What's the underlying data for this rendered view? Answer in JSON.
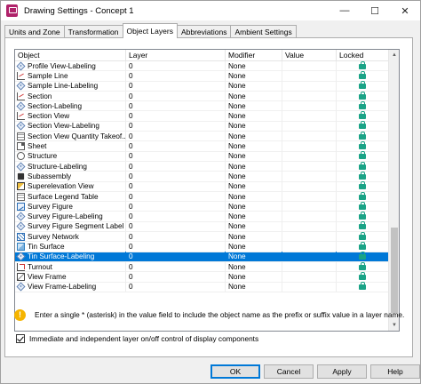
{
  "window": {
    "title": "Drawing Settings - Concept 1",
    "minimize": "—",
    "maximize": "☐",
    "close": "✕"
  },
  "tabs": [
    {
      "label": "Units and Zone",
      "active": false
    },
    {
      "label": "Transformation",
      "active": false
    },
    {
      "label": "Object Layers",
      "active": true
    },
    {
      "label": "Abbreviations",
      "active": false
    },
    {
      "label": "Ambient Settings",
      "active": false
    }
  ],
  "grid": {
    "columns": [
      "Object",
      "Layer",
      "Modifier",
      "Value",
      "Locked"
    ],
    "rows": [
      {
        "object": "Profile View-Labeling",
        "icon": "tag",
        "layer": "0",
        "modifier": "None",
        "value": "",
        "locked": true,
        "selected": false
      },
      {
        "object": "Sample Line",
        "icon": "line",
        "layer": "0",
        "modifier": "None",
        "value": "",
        "locked": true,
        "selected": false
      },
      {
        "object": "Sample Line-Labeling",
        "icon": "tag",
        "layer": "0",
        "modifier": "None",
        "value": "",
        "locked": true,
        "selected": false
      },
      {
        "object": "Section",
        "icon": "line",
        "layer": "0",
        "modifier": "None",
        "value": "",
        "locked": true,
        "selected": false
      },
      {
        "object": "Section-Labeling",
        "icon": "tag",
        "layer": "0",
        "modifier": "None",
        "value": "",
        "locked": true,
        "selected": false
      },
      {
        "object": "Section View",
        "icon": "line",
        "layer": "0",
        "modifier": "None",
        "value": "",
        "locked": true,
        "selected": false
      },
      {
        "object": "Section View-Labeling",
        "icon": "tag",
        "layer": "0",
        "modifier": "None",
        "value": "",
        "locked": true,
        "selected": false
      },
      {
        "object": "Section View Quantity Takeof...",
        "icon": "table",
        "layer": "0",
        "modifier": "None",
        "value": "",
        "locked": true,
        "selected": false
      },
      {
        "object": "Sheet",
        "icon": "sheet",
        "layer": "0",
        "modifier": "None",
        "value": "",
        "locked": true,
        "selected": false
      },
      {
        "object": "Structure",
        "icon": "struct",
        "layer": "0",
        "modifier": "None",
        "value": "",
        "locked": true,
        "selected": false
      },
      {
        "object": "Structure-Labeling",
        "icon": "tag",
        "layer": "0",
        "modifier": "None",
        "value": "",
        "locked": true,
        "selected": false
      },
      {
        "object": "Subassembly",
        "icon": "asm",
        "layer": "0",
        "modifier": "None",
        "value": "",
        "locked": true,
        "selected": false
      },
      {
        "object": "Superelevation View",
        "icon": "super",
        "layer": "0",
        "modifier": "None",
        "value": "",
        "locked": true,
        "selected": false
      },
      {
        "object": "Surface Legend Table",
        "icon": "table",
        "layer": "0",
        "modifier": "None",
        "value": "",
        "locked": true,
        "selected": false
      },
      {
        "object": "Survey Figure",
        "icon": "survey",
        "layer": "0",
        "modifier": "None",
        "value": "",
        "locked": true,
        "selected": false
      },
      {
        "object": "Survey Figure-Labeling",
        "icon": "tag",
        "layer": "0",
        "modifier": "None",
        "value": "",
        "locked": true,
        "selected": false
      },
      {
        "object": "Survey Figure Segment Label",
        "icon": "tag",
        "layer": "0",
        "modifier": "None",
        "value": "",
        "locked": true,
        "selected": false
      },
      {
        "object": "Survey Network",
        "icon": "net",
        "layer": "0",
        "modifier": "None",
        "value": "",
        "locked": true,
        "selected": false
      },
      {
        "object": "Tin Surface",
        "icon": "tin",
        "layer": "0",
        "modifier": "None",
        "value": "",
        "locked": true,
        "selected": false
      },
      {
        "object": "Tin Surface-Labeling",
        "icon": "tag",
        "layer": "0",
        "modifier": "None",
        "value": "",
        "locked": true,
        "selected": true
      },
      {
        "object": "Turnout",
        "icon": "turn",
        "layer": "0",
        "modifier": "None",
        "value": "",
        "locked": true,
        "selected": false
      },
      {
        "object": "View Frame",
        "icon": "view",
        "layer": "0",
        "modifier": "None",
        "value": "",
        "locked": true,
        "selected": false
      },
      {
        "object": "View Frame-Labeling",
        "icon": "tag",
        "layer": "0",
        "modifier": "None",
        "value": "",
        "locked": true,
        "selected": false
      }
    ]
  },
  "info": {
    "icon": "info-warning-icon",
    "text": "Enter a single * (asterisk) in the value field to include the object name as the prefix or suffix value in a layer name."
  },
  "checkbox": {
    "label": "Immediate and independent layer on/off control of display components",
    "checked": true
  },
  "buttons": {
    "ok": "OK",
    "cancel": "Cancel",
    "apply": "Apply",
    "help": "Help"
  }
}
